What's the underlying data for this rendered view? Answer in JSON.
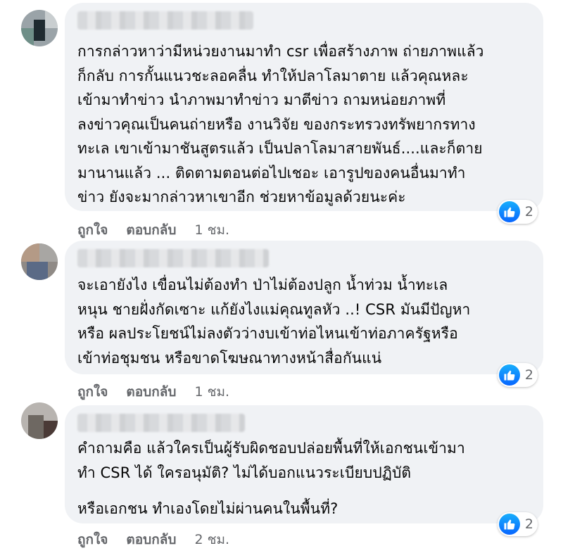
{
  "comments": [
    {
      "lines": [
        "การกล่าวหาว่ามีหน่วยงานมาทำ csr เพื่อสร้างภาพ ถ่ายภาพแล้ว",
        "ก็กลับ การกั้นแนวชะลอคลื่น ทำให้ปลาโลมาตาย แล้วคุณหละ",
        "เข้ามาทำข่าว นำภาพมาทำข่าว มาตีข่าว ถามหน่อยภาพที่",
        "ลงข่าวคุณเป็นคนถ่ายหรือ งานวิจัย ของกระทรวงทรัพยากรทาง",
        "ทะเล เขาเข้ามาชันสูตรแล้ว เป็นปลาโลมาสายพันธ์....และก็ตาย",
        "มานานแล้ว ... ติดตามตอนต่อไปเชอะ เอารูปของคนอื่นมาทำ",
        "ข่าว ยังจะมากล่าวหาเขาอีก ช่วยหาข้อมูลด้วยนะค่ะ"
      ],
      "reaction_count": "2",
      "like_label": "ถูกใจ",
      "reply_label": "ตอบกลับ",
      "time": "1 ชม."
    },
    {
      "lines": [
        "จะเอายังไง เขื่อนไม่ต้องทำ ป่าไม่ต้องปลูก น้ำท่วม น้ำทะเล",
        "หนุน ชายฝั่งกัดเซาะ แก้ยังไงแม่คุณทูลหัว ..! CSR มันมีปัญหา",
        "หรือ ผลประโยชน์ไม่ลงตัวว่างบเข้าท่อไหนเข้าท่อภาครัฐหรือ",
        "เข้าท่อชุมชน หรือขาดโฆษณาทางหน้าสื่อกันแน่"
      ],
      "reaction_count": "2",
      "like_label": "ถูกใจ",
      "reply_label": "ตอบกลับ",
      "time": "1 ชม."
    },
    {
      "lines": [
        "คำถามคือ แล้วใครเป็นผู้รับผิดชอบปล่อยพื้นที่ให้เอกชนเข้ามา",
        "ทำ CSR ได้ ใครอนุมัติ? ไม่ได้บอกแนวระเบียบปฏิบัติ"
      ],
      "lines_after_gap": [
        "หรือเอกชน ทำเองโดยไม่ผ่านคนในพื้นที่?"
      ],
      "reaction_count": "2",
      "like_label": "ถูกใจ",
      "reply_label": "ตอบกลับ",
      "time": "2 ชม."
    }
  ],
  "colors": {
    "bubble": "#f0f2f5",
    "meta_text": "#65676b",
    "like_blue": "#0866ff"
  },
  "icons": {
    "reaction": "like-thumbs-up-icon"
  }
}
